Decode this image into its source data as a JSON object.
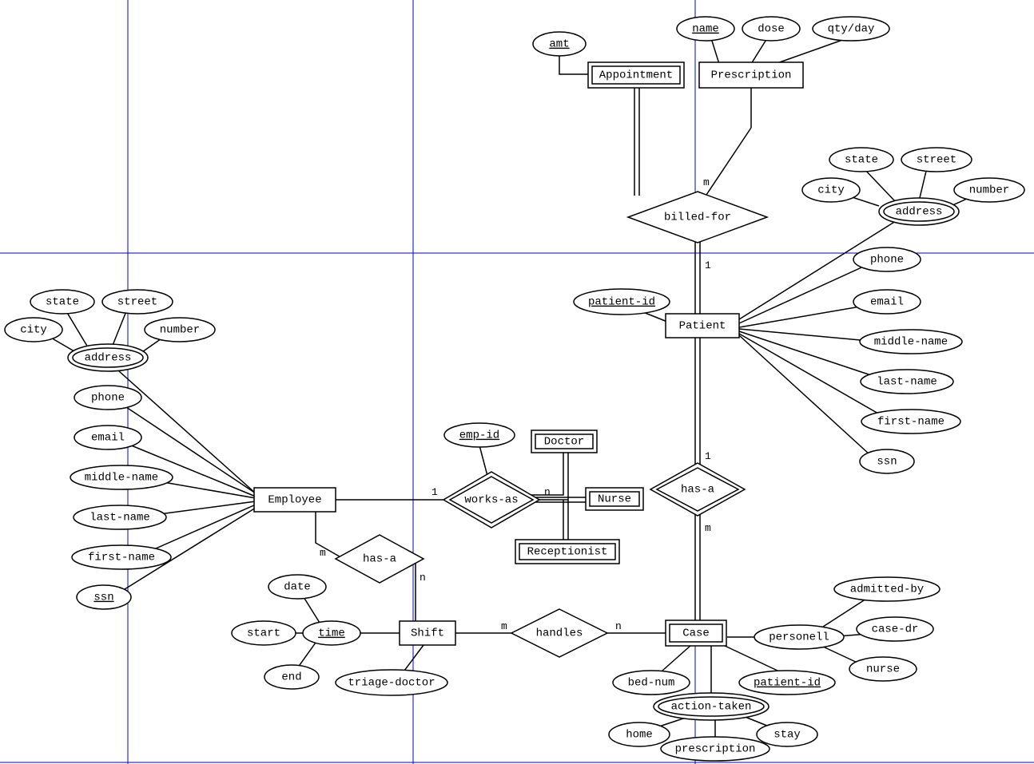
{
  "entities": {
    "appointment": "Appointment",
    "prescription": "Prescription",
    "patient": "Patient",
    "employee": "Employee",
    "doctor": "Doctor",
    "nurse": "Nurse",
    "receptionist": "Receptionist",
    "shift": "Shift",
    "case": "Case"
  },
  "relationships": {
    "billed_for": "billed-for",
    "has_a_patient_case": "has-a",
    "works_as": "works-as",
    "has_a_shift": "has-a",
    "handles": "handles"
  },
  "attributes": {
    "appointment": {
      "amt": "amt"
    },
    "prescription": {
      "name": "name",
      "dose": "dose",
      "qty_day": "qty/day"
    },
    "patient": {
      "patient_id": "patient-id",
      "address": "address",
      "state": "state",
      "street": "street",
      "city": "city",
      "number": "number",
      "phone": "phone",
      "email": "email",
      "middle_name": "middle-name",
      "last_name": "last-name",
      "first_name": "first-name",
      "ssn": "ssn"
    },
    "employee": {
      "address": "address",
      "state": "state",
      "street": "street",
      "city": "city",
      "number": "number",
      "phone": "phone",
      "email": "email",
      "middle_name": "middle-name",
      "last_name": "last-name",
      "first_name": "first-name",
      "ssn": "ssn"
    },
    "works_as": {
      "emp_id": "emp-id"
    },
    "shift": {
      "time": "time",
      "date": "date",
      "start": "start",
      "end": "end",
      "triage_doctor": "triage-doctor"
    },
    "case": {
      "bed_num": "bed-num",
      "patient_id": "patient-id",
      "personell": "personell",
      "admitted_by": "admitted-by",
      "case_dr": "case-dr",
      "nurse": "nurse",
      "action_taken": "action-taken",
      "home": "home",
      "prescription": "prescription",
      "stay": "stay"
    }
  },
  "cardinalities": {
    "billed_for_top": "m",
    "billed_for_bottom": "1",
    "has_a_pc_top": "1",
    "has_a_pc_bottom": "m",
    "works_as_left": "1",
    "works_as_right": "n",
    "has_a_shift_left": "m",
    "has_a_shift_right": "n",
    "handles_left": "m",
    "handles_right": "n"
  }
}
